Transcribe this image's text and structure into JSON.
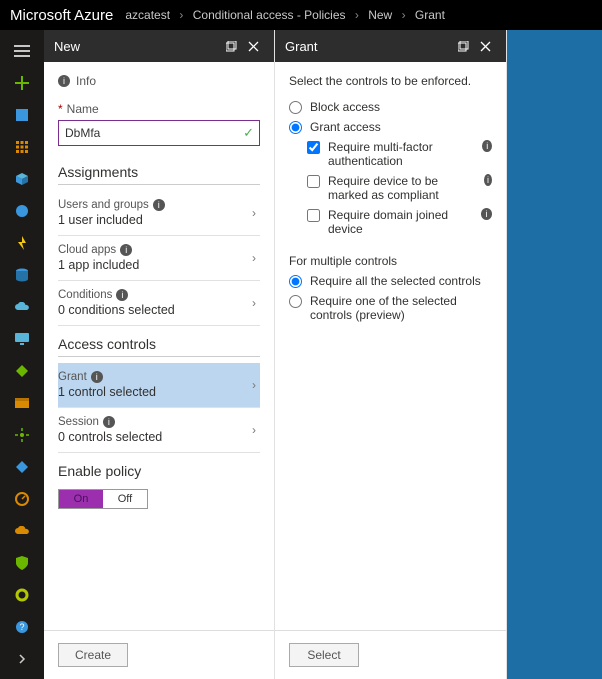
{
  "brand": "Microsoft Azure",
  "breadcrumbs": [
    "azcatest",
    "Conditional access - Policies",
    "New",
    "Grant"
  ],
  "bladeNew": {
    "title": "New",
    "info": "Info",
    "nameLabel": "Name",
    "nameValue": "DbMfa",
    "assignmentsTitle": "Assignments",
    "assignments": {
      "users": {
        "label": "Users and groups",
        "sub": "1 user included"
      },
      "apps": {
        "label": "Cloud apps",
        "sub": "1 app included"
      },
      "cond": {
        "label": "Conditions",
        "sub": "0 conditions selected"
      }
    },
    "accessTitle": "Access controls",
    "access": {
      "grant": {
        "label": "Grant",
        "sub": "1 control selected"
      },
      "session": {
        "label": "Session",
        "sub": "0 controls selected"
      }
    },
    "enablePolicy": "Enable policy",
    "toggle": {
      "on": "On",
      "off": "Off"
    },
    "create": "Create"
  },
  "bladeGrant": {
    "title": "Grant",
    "intro": "Select the controls to be enforced.",
    "accessMode": {
      "block": "Block access",
      "grant": "Grant access"
    },
    "controls": {
      "mfa": "Require multi-factor authentication",
      "compliant": "Require device to be marked as compliant",
      "domain": "Require domain joined device"
    },
    "multipleTitle": "For multiple controls",
    "multiple": {
      "all": "Require all the selected controls",
      "one": "Require one of the selected controls (preview)"
    },
    "select": "Select"
  },
  "colors": {
    "sidebar": "#1b1a19",
    "accent": "#9b2fae",
    "selected": "#bcd6ef",
    "right": "#1c6ea4"
  }
}
